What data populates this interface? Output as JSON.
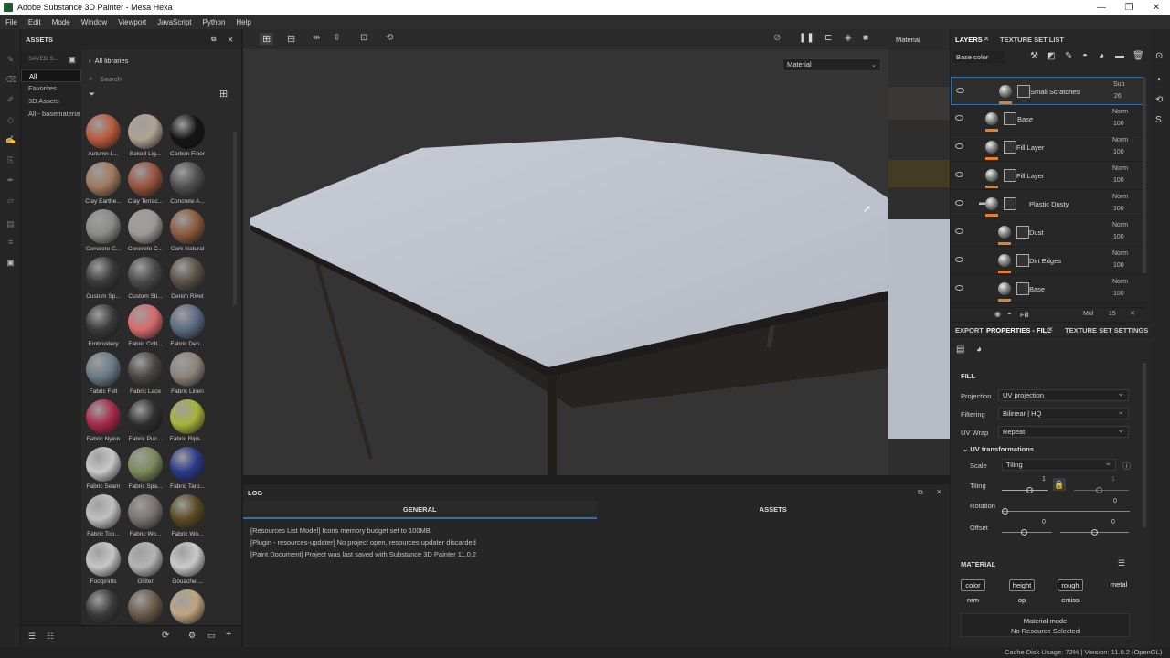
{
  "window": {
    "title": "Adobe Substance 3D Painter - Mesa Hexa"
  },
  "menu": [
    "File",
    "Edit",
    "Mode",
    "Window",
    "Viewport",
    "JavaScript",
    "Python",
    "Help"
  ],
  "assets": {
    "title": "ASSETS",
    "saved": "SAVED S...",
    "breadcrumb": "All libraries",
    "search_placeholder": "Search",
    "libraries": [
      "All",
      "Favorites",
      "3D Assets",
      "All - basemateria"
    ],
    "items": [
      {
        "name": "Autumn L...",
        "color": "#b85a3c"
      },
      {
        "name": "Baked Lig...",
        "color": "#b0a290"
      },
      {
        "name": "Carbon Fiber",
        "color": "#141414"
      },
      {
        "name": "Clay Earthe...",
        "color": "#a0785e"
      },
      {
        "name": "Clay Terrac...",
        "color": "#98523e"
      },
      {
        "name": "Concrete A...",
        "color": "#505050"
      },
      {
        "name": "Concrete C...",
        "color": "#8a8a88"
      },
      {
        "name": "Concrete C...",
        "color": "#9c9a94"
      },
      {
        "name": "Cork Natural",
        "color": "#8a5a3e"
      },
      {
        "name": "Custom Sp...",
        "color": "#3a3a3a"
      },
      {
        "name": "Custom Sti...",
        "color": "#4a4a4a"
      },
      {
        "name": "Denim Rivet",
        "color": "#5a5046"
      },
      {
        "name": "Embroidery",
        "color": "#3a3a3a"
      },
      {
        "name": "Fabric Cott...",
        "color": "#d86a6a"
      },
      {
        "name": "Fabric Den...",
        "color": "#5c6a82"
      },
      {
        "name": "Fabric Felt",
        "color": "#6a7a86"
      },
      {
        "name": "Fabric Lace",
        "color": "#4c4444"
      },
      {
        "name": "Fabric Linen",
        "color": "#8c847a"
      },
      {
        "name": "Fabric Nylon",
        "color": "#a82a4a"
      },
      {
        "name": "Fabric Puc...",
        "color": "#2e2e2e"
      },
      {
        "name": "Fabric Rips...",
        "color": "#a6b43a"
      },
      {
        "name": "Fabric Seam",
        "color": "#c8c8c8"
      },
      {
        "name": "Fabric Spa...",
        "color": "#7a8a5a"
      },
      {
        "name": "Fabric Tarp...",
        "color": "#2a3a8a"
      },
      {
        "name": "Fabric Top...",
        "color": "#c0c0c0"
      },
      {
        "name": "Fabric Wo...",
        "color": "#7a7270"
      },
      {
        "name": "Fabric Wo...",
        "color": "#5a4a22"
      },
      {
        "name": "Footprints",
        "color": "#c6c6c6"
      },
      {
        "name": "Glitter",
        "color": "#b4b4b4"
      },
      {
        "name": "Gouache ...",
        "color": "#cacaca"
      },
      {
        "name": "",
        "color": "#3a3a3a"
      },
      {
        "name": "",
        "color": "#6a5a4a"
      },
      {
        "name": "",
        "color": "#c0a482"
      }
    ]
  },
  "viewport": {
    "material_label": "Material",
    "side_label": "Material"
  },
  "log": {
    "title": "LOG",
    "tabs": [
      "GENERAL",
      "ASSETS"
    ],
    "lines": [
      "[Resources List Model] Icons memory budget set to 100MB.",
      "[Plugin - resources-updater] No project open, resources updater discarded",
      "[Paint Document] Project was last saved with Substance 3D Painter 11.0.2"
    ]
  },
  "layers_panel": {
    "tab_layers": "LAYERS",
    "tab_texset": "TEXTURE SET LIST",
    "channel": "Base color",
    "layers": [
      {
        "name": "Small Scratches",
        "mode": "Sub",
        "opacity": "26"
      },
      {
        "name": "Base",
        "mode": "Norm",
        "opacity": "100"
      },
      {
        "name": "Fill Layer",
        "mode": "Norm",
        "opacity": "100"
      },
      {
        "name": "Fill Layer",
        "mode": "Norm",
        "opacity": "100"
      },
      {
        "name": "Plastic Dusty",
        "mode": "Norm",
        "opacity": "100"
      },
      {
        "name": "Dust",
        "mode": "Norm",
        "opacity": "100"
      },
      {
        "name": "Dirt Edges",
        "mode": "Norm",
        "opacity": "100"
      },
      {
        "name": "Base",
        "mode": "Norm",
        "opacity": "100"
      }
    ],
    "fill_row": {
      "name": "Fill",
      "mode": "Mul",
      "opacity": "15"
    }
  },
  "props": {
    "tab_export": "EXPORT",
    "tab_props": "PROPERTIES - FILL",
    "tab_tss": "TEXTURE SET SETTINGS",
    "section": "FILL",
    "projection_label": "Projection",
    "projection": "UV projection",
    "filtering_label": "Filtering",
    "filtering": "Bilinear | HQ",
    "uvwrap_label": "UV Wrap",
    "uvwrap": "Repeat",
    "uvt": "UV transformations",
    "scale_label": "Scale",
    "scale": "Tiling",
    "tiling_label": "Tiling",
    "tiling_a": "1",
    "tiling_b": "1",
    "rotation_label": "Rotation",
    "rotation": "0",
    "offset_label": "Offset",
    "offset_a": "0",
    "offset_b": "0",
    "material": "MATERIAL",
    "channels": [
      "color",
      "height",
      "rough",
      "metal",
      "nrm",
      "op",
      "emiss"
    ],
    "mode_title": "Material mode",
    "mode_sub": "No Resource Selected"
  },
  "status": {
    "text": "Cache Disk Usage:   72% | Version: 11.0.2 (OpenGL)"
  }
}
